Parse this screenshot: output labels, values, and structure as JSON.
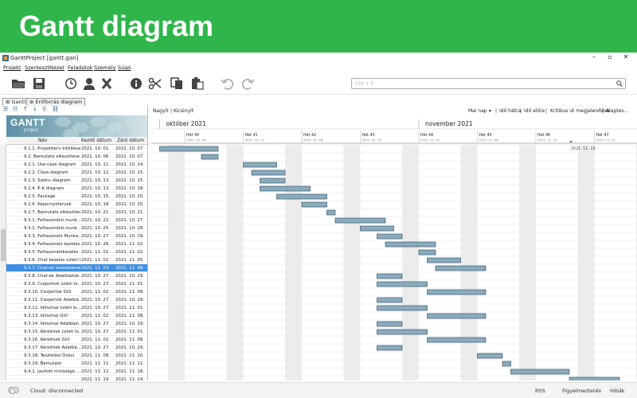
{
  "banner": {
    "title": "Gantt diagram"
  },
  "window": {
    "title": "GanttProject [gantt.gan]",
    "minimize": "–",
    "restore": "▫",
    "close": "✕"
  },
  "menu": [
    "Projekt",
    "Szerkeszt",
    "Nézet",
    "Feladatok",
    "Személy",
    "Súgó"
  ],
  "search": {
    "placeholder": "Ctrl + F"
  },
  "tabs": [
    "Gantt",
    "Erőforrás diagram"
  ],
  "logo": {
    "main": "GANTT",
    "sub": "project"
  },
  "table": {
    "headers": {
      "name": "Név",
      "start": "Kezdő dátum",
      "end": "Záró dátum"
    },
    "rows": [
      {
        "name": "9.1.1. Projektterv kitöltése",
        "start": "2021. 10. 01.",
        "end": "2021. 10. 07."
      },
      {
        "name": "9.2. Bemutató elkészítése",
        "start": "2021. 10. 06.",
        "end": "2021. 10. 07."
      },
      {
        "name": "9.2.1. Use-case diagram",
        "start": "2021. 10. 11.",
        "end": "2021. 10. 14."
      },
      {
        "name": "9.2.2. Class-diagram",
        "start": "2021. 10. 12.",
        "end": "2021. 10. 15."
      },
      {
        "name": "9.2.3. Szekv.-diagram",
        "start": "2021. 10. 13.",
        "end": "2021. 10. 15."
      },
      {
        "name": "9.2.4. E-K diagram",
        "start": "2021. 10. 13.",
        "end": "2021. 10. 18."
      },
      {
        "name": "9.2.5. Package",
        "start": "2021. 10. 15.",
        "end": "2021. 10. 20."
      },
      {
        "name": "9.2.6. Képernyőtervek",
        "start": "2021. 10. 18.",
        "end": "2021. 10. 20."
      },
      {
        "name": "9.2.7. Bemutató elkészítése",
        "start": "2021. 10. 21.",
        "end": "2021. 10. 21."
      },
      {
        "name": "9.3.1. Felhasználói munk...",
        "start": "2021. 10. 22.",
        "end": "2021. 10. 27."
      },
      {
        "name": "9.3.2. Felhasználói munk...",
        "start": "2021. 10. 25.",
        "end": "2021. 10. 28."
      },
      {
        "name": "9.3.3. Felhasználó Munka...",
        "start": "2021. 10. 27.",
        "end": "2021. 10. 29."
      },
      {
        "name": "9.3.4. Felhasználó kezelés...",
        "start": "2021. 10. 28.",
        "end": "2021. 11. 02."
      },
      {
        "name": "9.3.5. Felhasználókezelés ...",
        "start": "2021. 11. 01.",
        "end": "2021. 11. 02."
      },
      {
        "name": "9.3.6. Chat kezelés üzleti l...",
        "start": "2021. 11. 02.",
        "end": "2021. 11. 05."
      },
      {
        "name": "9.3.7. Chat-ek kezelésének...",
        "start": "2021. 11. 03.",
        "end": "2021. 11. 08."
      },
      {
        "name": "9.3.8. Chat-ek Adatbázisk...",
        "start": "2021. 10. 27.",
        "end": "2021. 10. 29."
      },
      {
        "name": "9.3.9. Csoportok üzleti lo...",
        "start": "2021. 10. 27.",
        "end": "2021. 11. 01."
      },
      {
        "name": "9.3.10. Csoportok GUI",
        "start": "2021. 11. 02.",
        "end": "2021. 11. 08."
      },
      {
        "name": "9.3.11. Csoportok Adatbá...",
        "start": "2021. 10. 27.",
        "end": "2021. 10. 29."
      },
      {
        "name": "9.3.12. Idővonal üzleti lo...",
        "start": "2021. 10. 27.",
        "end": "2021. 11. 01."
      },
      {
        "name": "9.3.13. Idővonal GUI",
        "start": "2021. 11. 02.",
        "end": "2021. 11. 08."
      },
      {
        "name": "9.3.14. Idővonal Adatbázi...",
        "start": "2021. 10. 27.",
        "end": "2021. 10. 29."
      },
      {
        "name": "9.3.15. Kérelmek üzleti lo...",
        "start": "2021. 10. 27.",
        "end": "2021. 11. 01."
      },
      {
        "name": "9.3.16. Kérelmek GUI",
        "start": "2021. 11. 02.",
        "end": "2021. 11. 08."
      },
      {
        "name": "9.3.17. Kérelmek Adatbá...",
        "start": "2021. 10. 27.",
        "end": "2021. 10. 29."
      },
      {
        "name": "9.3.18. Tesztelési Doksi",
        "start": "2021. 11. 08.",
        "end": "2021. 11. 10."
      },
      {
        "name": "9.3.19. Bemutató",
        "start": "2021. 11. 11.",
        "end": "2021. 11. 11."
      },
      {
        "name": "9.4.1. Javított minőségű ...",
        "start": "2021. 11. 12.",
        "end": "2021. 11. 18."
      },
      {
        "name": "",
        "start": "2021. 11. 19.",
        "end": "2021. 11. 24."
      }
    ],
    "selected_index": 15
  },
  "chart_toolbar": {
    "zoom_in": "Nagyít",
    "zoom_out": "Kicsinyít",
    "today": "Mai nap",
    "back": "Idő hátra",
    "forward": "Idő előre",
    "critical": "Kritikus út megjelenítése",
    "baselines": "Alaptev..."
  },
  "chart_data": {
    "type": "gantt",
    "months": [
      {
        "label": "október 2021",
        "date": "2021-10-01"
      },
      {
        "label": "november 2021",
        "date": "2021-11-01"
      }
    ],
    "weeks": [
      {
        "label": "Hét 40",
        "date": "2021. 10. 04.",
        "iso": "2021-10-04"
      },
      {
        "label": "Hét 41",
        "date": "2021. 10. 11.",
        "iso": "2021-10-11"
      },
      {
        "label": "Hét 42",
        "date": "2021. 10. 18.",
        "iso": "2021-10-18"
      },
      {
        "label": "Hét 43",
        "date": "2021. 10. 25.",
        "iso": "2021-10-25"
      },
      {
        "label": "Hét 44",
        "date": "2021. 11. 01.",
        "iso": "2021-11-01"
      },
      {
        "label": "Hét 45",
        "date": "2021. 11. 08.",
        "iso": "2021-11-08"
      },
      {
        "label": "Hét 46",
        "date": "2021. 11. 15.",
        "iso": "2021-11-15"
      },
      {
        "label": "Hét 47",
        "date": "2021. 11. 22.",
        "iso": "2021-11-22"
      }
    ],
    "tasks": [
      {
        "start": "2021-10-01",
        "end": "2021-10-07"
      },
      {
        "start": "2021-10-06",
        "end": "2021-10-07"
      },
      {
        "start": "2021-10-11",
        "end": "2021-10-14"
      },
      {
        "start": "2021-10-12",
        "end": "2021-10-15"
      },
      {
        "start": "2021-10-13",
        "end": "2021-10-15"
      },
      {
        "start": "2021-10-13",
        "end": "2021-10-18"
      },
      {
        "start": "2021-10-15",
        "end": "2021-10-20"
      },
      {
        "start": "2021-10-18",
        "end": "2021-10-20"
      },
      {
        "start": "2021-10-21",
        "end": "2021-10-21"
      },
      {
        "start": "2021-10-22",
        "end": "2021-10-27"
      },
      {
        "start": "2021-10-25",
        "end": "2021-10-28"
      },
      {
        "start": "2021-10-27",
        "end": "2021-10-29"
      },
      {
        "start": "2021-10-28",
        "end": "2021-11-02"
      },
      {
        "start": "2021-11-01",
        "end": "2021-11-02"
      },
      {
        "start": "2021-11-02",
        "end": "2021-11-05"
      },
      {
        "start": "2021-11-03",
        "end": "2021-11-08"
      },
      {
        "start": "2021-10-27",
        "end": "2021-10-29"
      },
      {
        "start": "2021-10-27",
        "end": "2021-11-01"
      },
      {
        "start": "2021-11-02",
        "end": "2021-11-08"
      },
      {
        "start": "2021-10-27",
        "end": "2021-10-29"
      },
      {
        "start": "2021-10-27",
        "end": "2021-11-01"
      },
      {
        "start": "2021-11-02",
        "end": "2021-11-08"
      },
      {
        "start": "2021-10-27",
        "end": "2021-10-29"
      },
      {
        "start": "2021-10-27",
        "end": "2021-11-01"
      },
      {
        "start": "2021-11-02",
        "end": "2021-11-08"
      },
      {
        "start": "2021-10-27",
        "end": "2021-10-29"
      },
      {
        "start": "2021-11-08",
        "end": "2021-11-10"
      },
      {
        "start": "2021-11-11",
        "end": "2021-11-11"
      },
      {
        "start": "2021-11-12",
        "end": "2021-11-18"
      },
      {
        "start": "2021-11-19",
        "end": "2021-11-24"
      }
    ],
    "today_marker": {
      "label": "2021. 11. 19.",
      "date": "2021-11-19"
    },
    "grid": true,
    "bar_color": "#8aabbd",
    "weekend_color": "#ececec"
  },
  "status": {
    "cloud": "Cloud: disconnected",
    "rss": "RSS",
    "notes": "Figyelmeztetés",
    "errors": "Hibák"
  },
  "colors": {
    "banner": "#2fb54a",
    "selected_row": "#3b8fe6"
  }
}
